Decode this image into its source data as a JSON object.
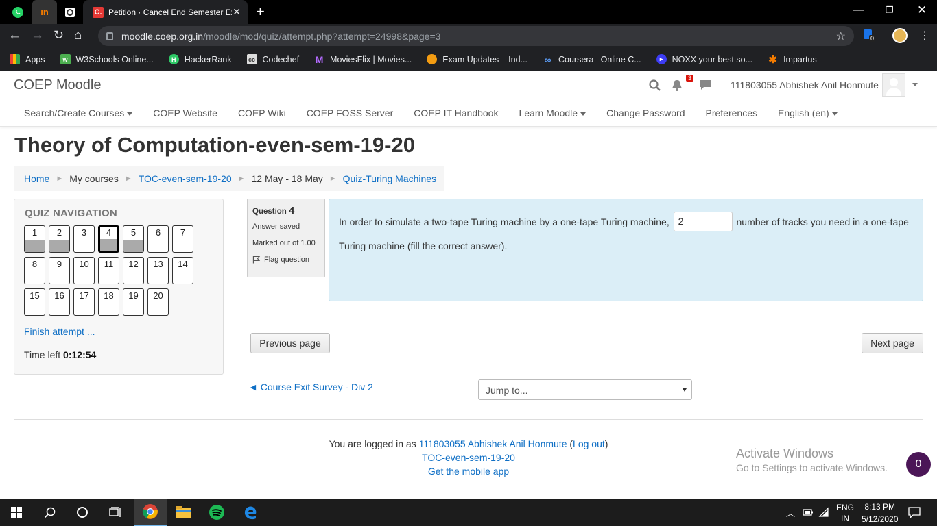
{
  "browser": {
    "active_tab_title": "Petition · Cancel End Semester Ex",
    "active_tab_favicon": "C.",
    "url_host": "moodle.coep.org.in",
    "url_path": "/moodle/mod/quiz/attempt.php?attempt=24998&page=3",
    "extension_badge": "0",
    "bookmarks": [
      {
        "label": "Apps",
        "icon": "apps-grid-icon",
        "color": "#f4b400"
      },
      {
        "label": "W3Schools Online...",
        "icon": "w3schools-icon",
        "color": "#4caf50"
      },
      {
        "label": "HackerRank",
        "icon": "hackerrank-icon",
        "color": "#2ec866"
      },
      {
        "label": "Codechef",
        "icon": "codechef-icon",
        "color": "#5b4638"
      },
      {
        "label": "MoviesFlix | Movies...",
        "icon": "moviesflix-icon",
        "color": "#7b3fe4"
      },
      {
        "label": "Exam Updates – Ind...",
        "icon": "exam-updates-icon",
        "color": "#f39c12"
      },
      {
        "label": "Coursera | Online C...",
        "icon": "coursera-icon",
        "color": "#2a73cc"
      },
      {
        "label": "NOXX your best so...",
        "icon": "noxx-icon",
        "color": "#3d3df5"
      },
      {
        "label": "Impartus",
        "icon": "impartus-icon",
        "color": "#f57c00"
      }
    ]
  },
  "moodle": {
    "brand": "COEP Moodle",
    "notification_count": "3",
    "user_name": "111803055 Abhishek Anil Honmute",
    "menu": [
      {
        "label": "Search/Create Courses",
        "dropdown": true
      },
      {
        "label": "COEP Website",
        "dropdown": false
      },
      {
        "label": "COEP Wiki",
        "dropdown": false
      },
      {
        "label": "COEP FOSS Server",
        "dropdown": false
      },
      {
        "label": "COEP IT Handbook",
        "dropdown": false
      },
      {
        "label": "Learn Moodle",
        "dropdown": true
      },
      {
        "label": "Change Password",
        "dropdown": false
      },
      {
        "label": "Preferences",
        "dropdown": false
      },
      {
        "label": "English (en)",
        "dropdown": true
      }
    ]
  },
  "page": {
    "title": "Theory of Computation-even-sem-19-20",
    "breadcrumb": [
      "Home",
      "My courses",
      "TOC-even-sem-19-20",
      "12 May - 18 May",
      "Quiz-Turing Machines"
    ]
  },
  "quiz_nav": {
    "title": "QUIZ NAVIGATION",
    "questions": [
      "1",
      "2",
      "3",
      "4",
      "5",
      "6",
      "7",
      "8",
      "9",
      "10",
      "11",
      "12",
      "13",
      "14",
      "15",
      "16",
      "17",
      "18",
      "19",
      "20"
    ],
    "answered": [
      "1",
      "2",
      "4",
      "5"
    ],
    "current": "4",
    "finish_label": "Finish attempt ...",
    "time_label": "Time left",
    "time_value": "0:12:54"
  },
  "question": {
    "label": "Question",
    "number": "4",
    "status": "Answer saved",
    "marks": "Marked out of 1.00",
    "flag_label": "Flag question",
    "text_before": "In order to simulate a two-tape Turing machine by a one-tape Turing machine,",
    "answer": "2",
    "text_after": "number of tracks you need in a one-tape Turing machine (fill the correct answer)."
  },
  "actions": {
    "previous_page": "Previous page",
    "next_page": "Next page",
    "prev_activity": "◄ Course Exit Survey - Div 2",
    "jump_to": "Jump to..."
  },
  "footer": {
    "logged_in_prefix": "You are logged in as",
    "user_link": "111803055 Abhishek Anil Honmute",
    "logout": "Log out",
    "course_link": "TOC-even-sem-19-20",
    "mobile_app": "Get the mobile app"
  },
  "watermark": {
    "line1": "Activate Windows",
    "line2": "Go to Settings to activate Windows."
  },
  "chat_badge": "0",
  "taskbar": {
    "lang_line1": "ENG",
    "lang_line2": "IN",
    "time": "8:13 PM",
    "date": "5/12/2020"
  }
}
